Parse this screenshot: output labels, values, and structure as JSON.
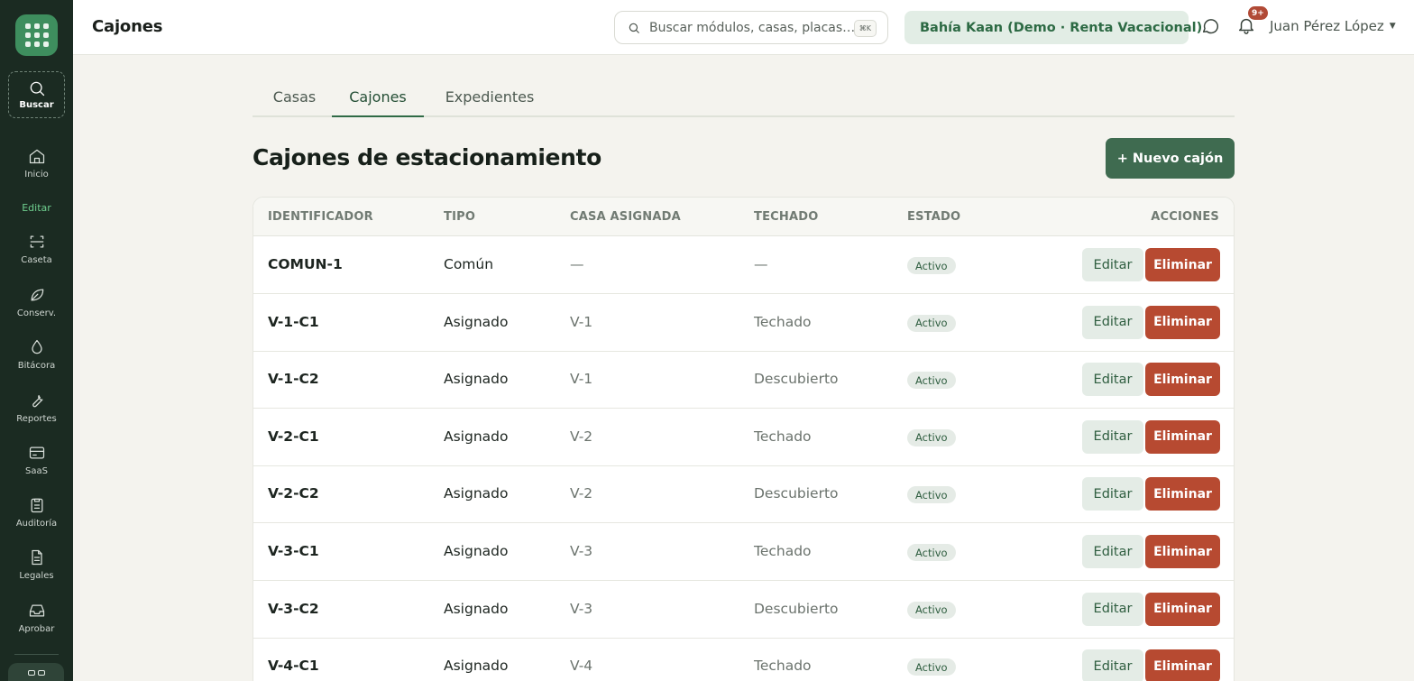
{
  "header": {
    "page_title": "Cajones",
    "search_placeholder": "Buscar módulos, casas, placas…",
    "search_shortcut": "⌘K",
    "org_selector": "Bahía Kaan (Demo · Renta Vacacional)",
    "notifications_badge": "9+",
    "user_name": "Juan Pérez López"
  },
  "sidebar": {
    "search_label": "Buscar",
    "home_label": "Inicio",
    "section_label": "Editar",
    "items": [
      {
        "label": "Caseta",
        "icon": "scan-icon"
      },
      {
        "label": "Conserv.",
        "icon": "leaf-icon"
      },
      {
        "label": "Bitácora",
        "icon": "drop-icon"
      },
      {
        "label": "Reportes",
        "icon": "wrench-icon"
      },
      {
        "label": "SaaS",
        "icon": "card-icon"
      },
      {
        "label": "Auditoría",
        "icon": "clipboard-icon"
      },
      {
        "label": "Legales",
        "icon": "document-icon"
      },
      {
        "label": "Aprobar",
        "icon": "inbox-icon"
      }
    ]
  },
  "tabs": [
    {
      "label": "Casas",
      "active": false
    },
    {
      "label": "Cajones",
      "active": true
    },
    {
      "label": "Expedientes",
      "active": false
    }
  ],
  "main": {
    "title": "Cajones de estacionamiento",
    "new_button": "+ Nuevo cajón"
  },
  "table": {
    "headers": [
      "IDENTIFICADOR",
      "TIPO",
      "CASA ASIGNADA",
      "TECHADO",
      "ESTADO",
      "ACCIONES"
    ],
    "edit_label": "Editar",
    "delete_label": "Eliminar",
    "rows": [
      {
        "id": "COMUN-1",
        "tipo": "Común",
        "casa": "—",
        "techado": "—",
        "estado": "Activo"
      },
      {
        "id": "V-1-C1",
        "tipo": "Asignado",
        "casa": "V-1",
        "techado": "Techado",
        "estado": "Activo"
      },
      {
        "id": "V-1-C2",
        "tipo": "Asignado",
        "casa": "V-1",
        "techado": "Descubierto",
        "estado": "Activo"
      },
      {
        "id": "V-2-C1",
        "tipo": "Asignado",
        "casa": "V-2",
        "techado": "Techado",
        "estado": "Activo"
      },
      {
        "id": "V-2-C2",
        "tipo": "Asignado",
        "casa": "V-2",
        "techado": "Descubierto",
        "estado": "Activo"
      },
      {
        "id": "V-3-C1",
        "tipo": "Asignado",
        "casa": "V-3",
        "techado": "Techado",
        "estado": "Activo"
      },
      {
        "id": "V-3-C2",
        "tipo": "Asignado",
        "casa": "V-3",
        "techado": "Descubierto",
        "estado": "Activo"
      },
      {
        "id": "V-4-C1",
        "tipo": "Asignado",
        "casa": "V-4",
        "techado": "Techado",
        "estado": "Activo"
      }
    ]
  },
  "colors": {
    "sidebar_bg": "#1b2b22",
    "brand_green": "#3e8e5e",
    "primary_button": "#3f6b50",
    "danger_button": "#b74a31"
  }
}
